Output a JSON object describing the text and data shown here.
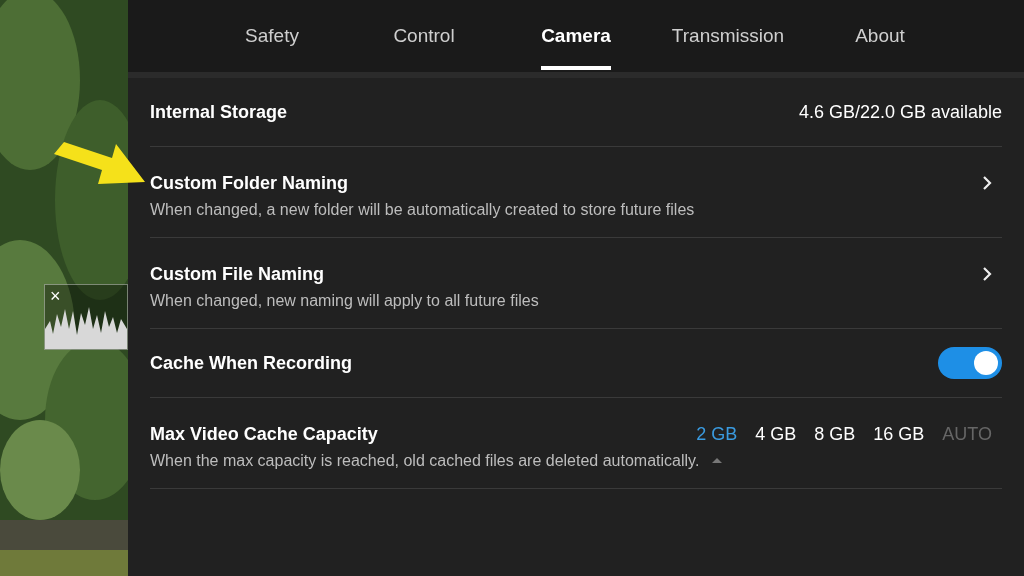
{
  "tabs": [
    {
      "label": "Safety",
      "selected": false
    },
    {
      "label": "Control",
      "selected": false
    },
    {
      "label": "Camera",
      "selected": true
    },
    {
      "label": "Transmission",
      "selected": false
    },
    {
      "label": "About",
      "selected": false
    }
  ],
  "histogram": {
    "close": "×"
  },
  "rows": [
    {
      "kind": "info",
      "title": "Internal Storage",
      "value": "4.6 GB/22.0 GB available"
    },
    {
      "kind": "link",
      "title": "Custom Folder Naming",
      "description": "When changed, a new folder will be automatically created to store future files"
    },
    {
      "kind": "link",
      "title": "Custom File Naming",
      "description": "When changed, new naming will apply to all future files"
    },
    {
      "kind": "toggle",
      "title": "Cache When Recording",
      "on": true
    },
    {
      "kind": "options",
      "title": "Max Video Cache Capacity",
      "description": "When the max capacity is reached, old cached files are deleted automatically.",
      "options": [
        {
          "label": "2 GB",
          "selected": true
        },
        {
          "label": "4 GB",
          "selected": false
        },
        {
          "label": "8 GB",
          "selected": false
        },
        {
          "label": "16 GB",
          "selected": false
        },
        {
          "label": "AUTO",
          "selected": false
        }
      ]
    }
  ]
}
